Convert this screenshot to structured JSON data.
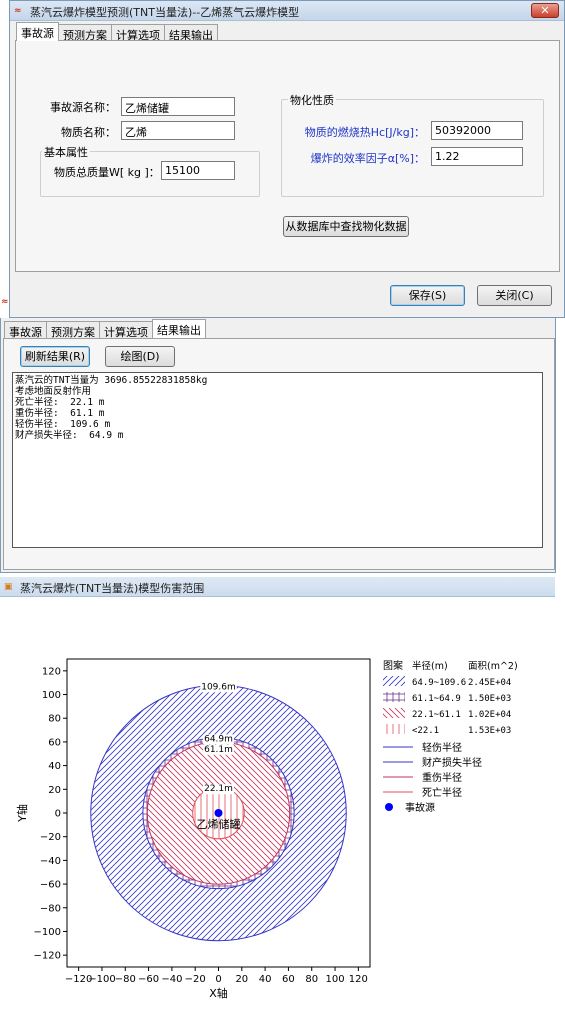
{
  "window1": {
    "title": "蒸汽云爆炸模型预测(TNT当量法)--乙烯蒸气云爆炸模型",
    "close_glyph": "✕",
    "tabs": [
      "事故源",
      "预测方案",
      "计算选项",
      "结果输出"
    ],
    "accident_source_label": "事故源名称：",
    "accident_source_value": "乙烯储罐",
    "substance_label": "物质名称：",
    "substance_value": "乙烯",
    "basic_group_title": "基本属性",
    "total_mass_label": "物质总质量W[ kg ]：",
    "total_mass_value": "15100",
    "physchem_group_title": "物化性质",
    "heat_label": "物质的燃烧热Hc[J/kg]：",
    "heat_value": "50392000",
    "efficiency_label": "爆炸的效率因子α[%]：",
    "efficiency_value": "1.22",
    "db_button": "从数据库中查找物化数据",
    "save_button": "保存(S)",
    "close_button": "关闭(C)"
  },
  "window2": {
    "tabs": [
      "事故源",
      "预测方案",
      "计算选项",
      "结果输出"
    ],
    "refresh_button": "刷新结果(R)",
    "plot_button": "绘图(D)",
    "output_lines": [
      "蒸汽云的TNT当量为 3696.85522831858kg",
      "考虑地面反射作用",
      "死亡半径:  22.1 m",
      "重伤半径:  61.1 m",
      "轻伤半径:  109.6 m",
      "财产损失半径:  64.9 m"
    ]
  },
  "window3": {
    "title": "蒸汽云爆炸(TNT当量法)模型伤害范围"
  },
  "colors": {
    "light_injury": "#3535c8",
    "property_loss": "#3535c8",
    "serious_injury": "#c8325a",
    "death": "#e0505a",
    "source_dot": "#0000ff"
  },
  "chart_data": {
    "type": "area",
    "xlabel": "X轴",
    "ylabel": "Y轴",
    "xlim": [
      -130,
      130
    ],
    "ylim": [
      -130,
      130
    ],
    "xticks": [
      -120,
      -100,
      -80,
      -60,
      -40,
      -20,
      0,
      20,
      40,
      60,
      80,
      100,
      120
    ],
    "yticks": [
      120,
      100,
      80,
      60,
      40,
      20,
      0,
      -20,
      -40,
      -60,
      -80,
      -100,
      -120
    ],
    "circles": [
      {
        "name": "轻伤半径",
        "radius": 109.6,
        "label": "109.6m",
        "color": "#3535c8"
      },
      {
        "name": "财产损失半径",
        "radius": 64.9,
        "label": "64.9m",
        "color": "#3535c8"
      },
      {
        "name": "重伤半径",
        "radius": 61.1,
        "label": "61.1m",
        "color": "#c8325a"
      },
      {
        "name": "死亡半径",
        "radius": 22.1,
        "label": "22.1m",
        "color": "#e0505a"
      }
    ],
    "source": {
      "x": 0,
      "y": 0,
      "name": "乙烯储罐"
    },
    "legend": {
      "headers": [
        "图案",
        "半径(m)",
        "面积(m^2)"
      ],
      "hatch_rows": [
        {
          "range": "64.9~109.6",
          "area": "2.45E+04",
          "pattern": "diag",
          "color": "#3535c8"
        },
        {
          "range": "61.1~64.9",
          "area": "1.50E+03",
          "pattern": "cross",
          "color": "#6a2a8a"
        },
        {
          "range": "22.1~61.1",
          "area": "1.02E+04",
          "pattern": "back",
          "color": "#c8325a"
        },
        {
          "range": "<22.1",
          "area": "1.53E+03",
          "pattern": "vert",
          "color": "#e0505a"
        }
      ],
      "line_rows": [
        {
          "label": "轻伤半径",
          "color": "#3535c8"
        },
        {
          "label": "财产损失半径",
          "color": "#3535c8"
        },
        {
          "label": "重伤半径",
          "color": "#c8325a"
        },
        {
          "label": "死亡半径",
          "color": "#e0505a"
        }
      ],
      "dot_row": {
        "label": "事故源",
        "color": "#0000ff"
      },
      "placement": "right"
    }
  }
}
